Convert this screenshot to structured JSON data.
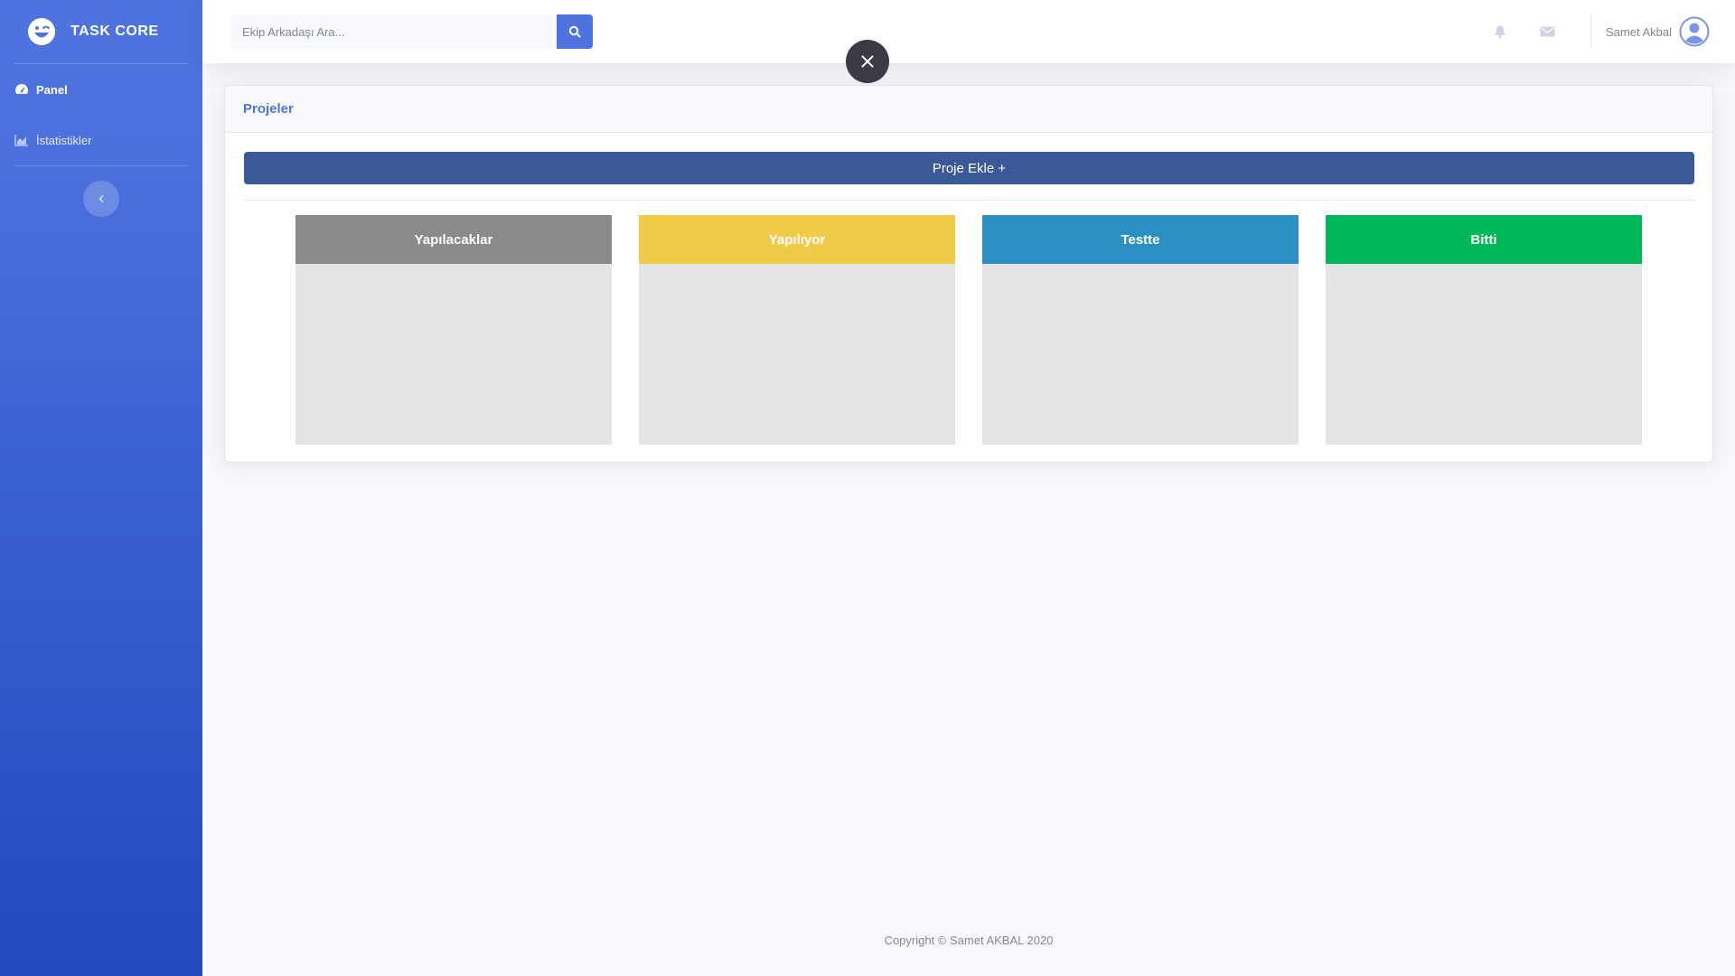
{
  "brand": {
    "name": "TASK CORE"
  },
  "sidebar": {
    "items": [
      {
        "label": "Panel",
        "icon": "tachometer-icon",
        "active": true
      },
      {
        "label": "İstatistikler",
        "icon": "chart-area-icon",
        "active": false
      }
    ],
    "toggle_icon": "chevron-left-icon"
  },
  "topbar": {
    "search_placeholder": "Ekip Arkadaşı Ara...",
    "user_name": "Samet Akbal"
  },
  "card": {
    "title": "Projeler",
    "add_button": "Proje Ekle +",
    "columns": [
      {
        "label": "Yapılacaklar",
        "color": "#8a8a8a"
      },
      {
        "label": "Yapılıyor",
        "color": "#f2ca4a"
      },
      {
        "label": "Testte",
        "color": "#2b8fc1"
      },
      {
        "label": "Bitti",
        "color": "#00b85c"
      }
    ]
  },
  "footer": {
    "text": "Copyright © Samet AKBAL 2020"
  },
  "colors": {
    "primary": "#4e73df",
    "button": "#3b5998"
  }
}
